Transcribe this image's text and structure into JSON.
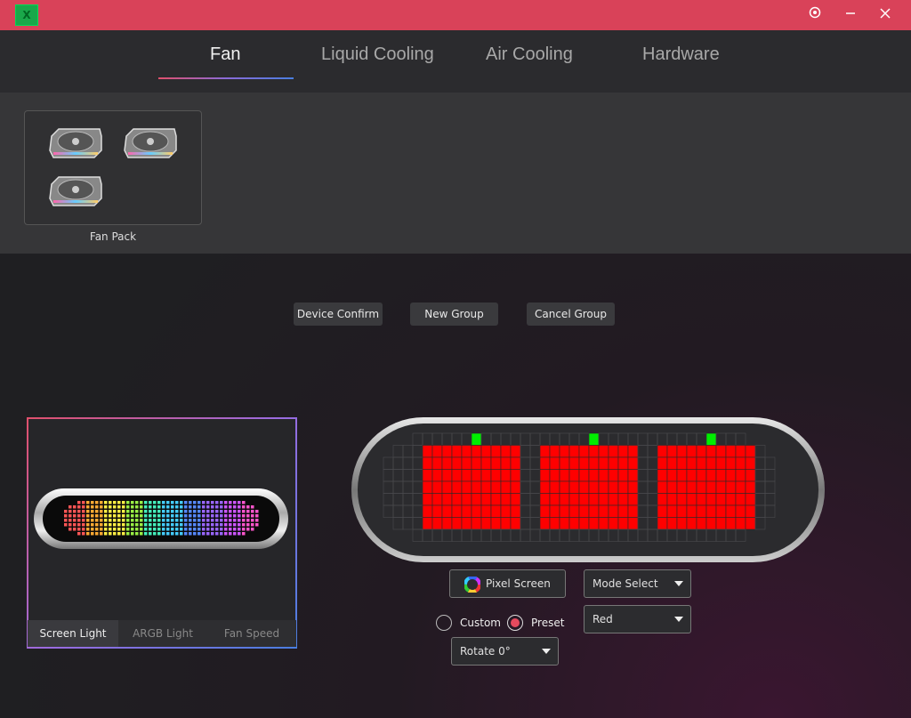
{
  "window": {
    "logo_text": "X",
    "settings_icon": "gear-icon",
    "minimize_icon": "minimize-icon",
    "close_icon": "close-icon"
  },
  "tabs": [
    {
      "label": "Fan",
      "active": true
    },
    {
      "label": "Liquid Cooling",
      "active": false
    },
    {
      "label": "Air Cooling",
      "active": false
    },
    {
      "label": "Hardware",
      "active": false
    }
  ],
  "devices": {
    "pack_label": "Fan Pack",
    "fan_count": 3
  },
  "actions": {
    "device_confirm": "Device Confirm",
    "new_group": "New Group",
    "cancel_group": "Cancel Group"
  },
  "preview": {
    "tabs": [
      {
        "label": "Screen Light",
        "active": true
      },
      {
        "label": "ARGB Light",
        "active": false
      },
      {
        "label": "Fan Speed",
        "active": false
      }
    ]
  },
  "controls": {
    "pixel_screen": "Pixel Screen",
    "mode_select": "Mode Select",
    "color_select": "Red",
    "custom_label": "Custom",
    "preset_label": "Preset",
    "preset_selected": true,
    "rotate": "Rotate 0°"
  },
  "colors": {
    "accent": "#d94259",
    "pixel_red": "#ff0000",
    "pixel_green": "#00ee00"
  }
}
